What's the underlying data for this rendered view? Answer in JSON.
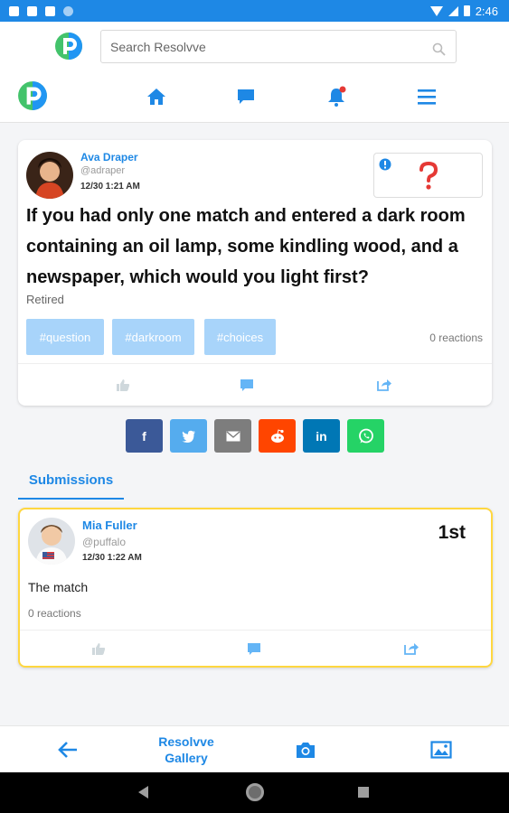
{
  "status_bar": {
    "time": "2:46"
  },
  "header": {
    "search_placeholder": "Search Resolvve"
  },
  "colors": {
    "accent": "#1e88e5",
    "tag_bg": "#a8d4fa",
    "winner_border": "#ffd740",
    "notification_dot": "#e53935"
  },
  "question": {
    "author_name": "Ava Draper",
    "author_handle": "@adraper",
    "time": "12/30 1:21 AM",
    "status_icon": "question-mark-icon",
    "text": "If you had only one match and entered a dark room containing an oil lamp, some kindling wood, and a newspaper, which would you light first?",
    "category": "Retired",
    "tags": [
      "#question",
      "#darkroom",
      "#choices"
    ],
    "reactions": "0 reactions"
  },
  "share": {
    "buttons": [
      {
        "name": "facebook",
        "label": "f",
        "color": "#3b5998"
      },
      {
        "name": "twitter",
        "label": "",
        "color": "#55acee"
      },
      {
        "name": "email",
        "label": "",
        "color": "#7d7d7d"
      },
      {
        "name": "reddit",
        "label": "",
        "color": "#ff4500"
      },
      {
        "name": "linkedin",
        "label": "in",
        "color": "#0077b5"
      },
      {
        "name": "whatsapp",
        "label": "",
        "color": "#25d366"
      }
    ]
  },
  "tabs": {
    "submissions": "Submissions"
  },
  "submission": {
    "author_name": "Mia Fuller",
    "author_handle": "@puffalo",
    "time": "12/30 1:22 AM",
    "rank": "1st",
    "text": "The match",
    "reactions": "0 reactions"
  },
  "bottom_bar": {
    "gallery_line1": "Resolvve",
    "gallery_line2": "Gallery"
  }
}
